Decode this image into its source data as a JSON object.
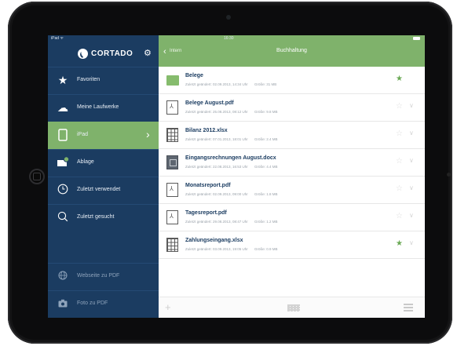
{
  "status": {
    "carrier": "iPad ᯤ",
    "time": "16:30"
  },
  "sidebar": {
    "brand": "CORTADO",
    "items": [
      {
        "label": "Favoriten",
        "icon": "star-icon"
      },
      {
        "label": "Meine Laufwerke",
        "icon": "cloud-icon"
      },
      {
        "label": "iPad",
        "icon": "ipad-icon",
        "active": true
      },
      {
        "label": "Ablage",
        "icon": "inbox-icon"
      },
      {
        "label": "Zuletzt verwendet",
        "icon": "clock-icon"
      },
      {
        "label": "Zuletzt gesucht",
        "icon": "search-icon"
      }
    ],
    "bottom_items": [
      {
        "label": "Webseite zu PDF",
        "icon": "globe-icon"
      },
      {
        "label": "Foto zu PDF",
        "icon": "camera-icon"
      }
    ]
  },
  "header": {
    "back_label": "Intern",
    "title": "Buchhaltung"
  },
  "files": [
    {
      "name": "Belege",
      "date": "Zuletzt geändert: 02.09.2013, 14:34 Uhr",
      "size": "Größe: 31 MB",
      "type": "folder",
      "favorite": true
    },
    {
      "name": "Belege August.pdf",
      "date": "Zuletzt geändert: 25.08.2013, 08:12 Uhr",
      "size": "Größe: 9.8 MB",
      "type": "pdf",
      "favorite": false
    },
    {
      "name": "Bilanz 2012.xlsx",
      "date": "Zuletzt geändert: 07.01.2013, 18:01 Uhr",
      "size": "Größe: 2.4 MB",
      "type": "xlsx",
      "favorite": false
    },
    {
      "name": "Eingangsrechnungen August.docx",
      "date": "Zuletzt geändert: 22.08.2013, 16:53 Uhr",
      "size": "Größe: 4.4 MB",
      "type": "docx",
      "favorite": false
    },
    {
      "name": "Monatsreport.pdf",
      "date": "Zuletzt geändert: 02.09.2013, 09:00 Uhr",
      "size": "Größe: 1.8 MB",
      "type": "pdf",
      "favorite": false
    },
    {
      "name": "Tagesreport.pdf",
      "date": "Zuletzt geändert: 29.08.2013, 08:47 Uhr",
      "size": "Größe: 1.2 MB",
      "type": "pdf",
      "favorite": false
    },
    {
      "name": "Zahlungseingang.xlsx",
      "date": "Zuletzt geändert: 03.09.2013, 19:05 Uhr",
      "size": "Größe: 0.9 MB",
      "type": "xlsx",
      "favorite": true
    }
  ],
  "colors": {
    "sidebar": "#1b3c61",
    "accent": "#7fb26b",
    "title": "#1b3c61"
  }
}
